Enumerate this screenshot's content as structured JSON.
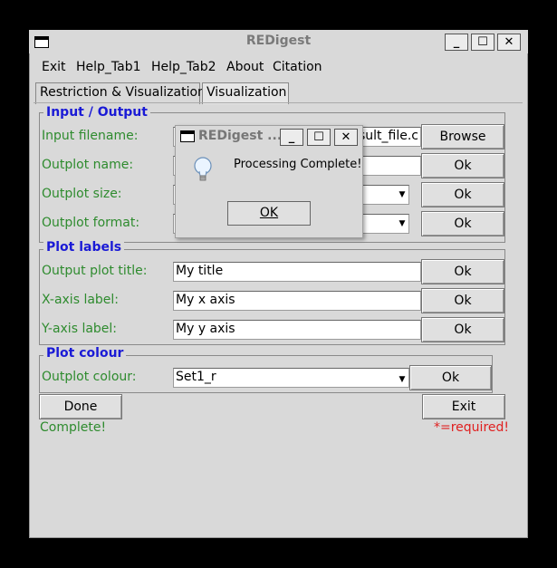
{
  "window": {
    "title": "REDigest"
  },
  "menu": [
    "Exit",
    "Help_Tab1",
    "Help_Tab2",
    "About",
    "Citation"
  ],
  "tabs": [
    {
      "label": "Restriction & Visualization",
      "selected": false
    },
    {
      "label": "Visualization",
      "selected": true
    }
  ],
  "io": {
    "legend": "Input / Output",
    "input_filename_label": "Input filename:",
    "input_filename_value": "sult_file.c",
    "browse_label": "Browse",
    "outplot_name_label": "Outplot name:",
    "outplot_name_value": "",
    "outplot_size_label": "Outplot size:",
    "outplot_size_value": "",
    "outplot_format_label": "Outplot format:",
    "outplot_format_value": "",
    "ok_label": "Ok"
  },
  "plot_labels": {
    "legend": "Plot labels",
    "title_label": "Output plot title:",
    "title_value": "My title",
    "x_label": "X-axis label:",
    "x_value": "My x axis",
    "y_label": "Y-axis label:",
    "y_value": "My y axis",
    "ok_label": "Ok"
  },
  "plot_colour": {
    "legend": "Plot colour",
    "label": "Outplot colour:",
    "value": "Set1_r",
    "ok_label": "Ok"
  },
  "actions": {
    "done_label": "Done",
    "exit_label": "Exit"
  },
  "status": {
    "message": "Complete!",
    "required_note": "*=required!",
    "message_color": "#2e8b2e",
    "required_color": "#e02020"
  },
  "dialog": {
    "title": "REDigest ...",
    "message": "Processing Complete!",
    "ok_label": "OK",
    "icon": "lightbulb-icon"
  },
  "colors": {
    "label_green": "#2e8b2e",
    "legend_blue": "#1a1ad6"
  }
}
